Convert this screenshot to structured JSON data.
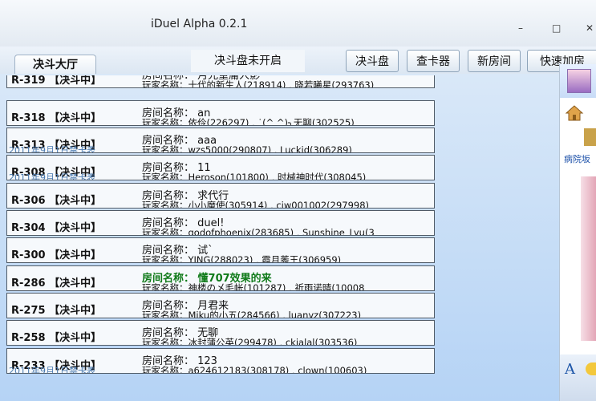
{
  "window": {
    "title": "iDuel Alpha 0.2.1",
    "minimize": "–",
    "maximize": "□",
    "close": "✕"
  },
  "tabs": [
    {
      "label": "决斗大厅"
    }
  ],
  "status": "决斗盘未开启",
  "toolbar": {
    "duel_disk": "决斗盘",
    "card_viewer": "查卡器",
    "new_room": "新房间",
    "quick_join": "快速加房"
  },
  "rooms": [
    {
      "id": "R-319",
      "state": "【决斗中】",
      "name": "房间名称：  月光重庸人影",
      "players": "玩家名称：十代的新生人(218914) , 晓若曦星(293763)",
      "sub": "",
      "highlight": false
    },
    {
      "id": "R-318",
      "state": "【决斗中】",
      "name": "房间名称：  an",
      "players": "玩家名称：依伶(226297) , ˙(^ ^)╮无聊(302525)",
      "sub": "",
      "highlight": false
    },
    {
      "id": "R-313",
      "state": "【决斗中】",
      "name": "房间名称：  aaa",
      "players": "玩家名称：wzs5000(290807) , Luckid(306289)",
      "sub": "2011年9月1日禁卡表",
      "highlight": false
    },
    {
      "id": "R-308",
      "state": "【决斗中】",
      "name": "房间名称：  11",
      "players": "玩家名称：Heroson(101800) , 时械神时代(308045)",
      "sub": "2011年9月1日禁卡表",
      "highlight": false
    },
    {
      "id": "R-306",
      "state": "【决斗中】",
      "name": "房间名称：  求代行",
      "players": "玩家名称：小小魔使(305914) , ciw001002(297998)",
      "sub": "",
      "highlight": false
    },
    {
      "id": "R-304",
      "state": "【决斗中】",
      "name": "房间名称：  duel!",
      "players": "玩家名称：godofphoenix(283685) , Sunshine_Lyu(3",
      "sub": "",
      "highlight": false
    },
    {
      "id": "R-300",
      "state": "【决斗中】",
      "name": "房间名称：  试`",
      "players": "玩家名称：YING(288023) , 霞月莠王(306959)",
      "sub": "",
      "highlight": false
    },
    {
      "id": "R-286",
      "state": "【决斗中】",
      "name": "房间名称：  懂707效果的来",
      "players": "玩家名称：神楼の乄毛帐(101287) , 祈雨诺晴(10008",
      "sub": "",
      "highlight": true
    },
    {
      "id": "R-275",
      "state": "【决斗中】",
      "name": "房间名称：  月君来",
      "players": "玩家名称：Miku的小五(284566) , luanyz(307223)",
      "sub": "",
      "highlight": false
    },
    {
      "id": "R-258",
      "state": "【决斗中】",
      "name": "房间名称：  无聊",
      "players": "玩家名称：冰封蒲公英(299478) , ckjalal(303536)",
      "sub": "",
      "highlight": false
    },
    {
      "id": "R-233",
      "state": "【决斗中】",
      "name": "房间名称：  123",
      "players": "玩家名称：a624612183(308178) , clown(100603)",
      "sub": "2011年9月1日禁卡表",
      "highlight": false
    }
  ],
  "side": {
    "link": "病院坂",
    "font_button": "A"
  },
  "colors": {
    "highlight_name": "#0f7a19",
    "list_background": "#b5d3f5",
    "row_border": "#4f5a66"
  }
}
